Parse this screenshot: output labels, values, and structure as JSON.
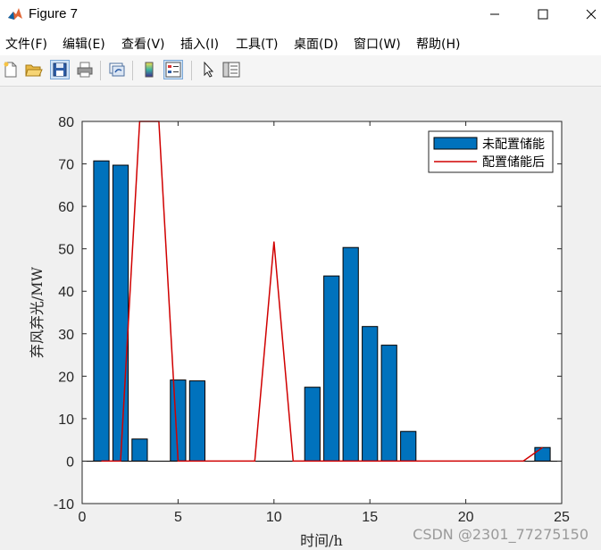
{
  "window": {
    "title": "Figure 7"
  },
  "menu": [
    "文件(F)",
    "编辑(E)",
    "查看(V)",
    "插入(I)",
    "工具(T)",
    "桌面(D)",
    "窗口(W)",
    "帮助(H)"
  ],
  "toolbar": {
    "buttons": [
      "new-figure",
      "open-file",
      "save-figure",
      "print-figure",
      "link-plot",
      "insert-colorbar",
      "insert-legend",
      "edit-plot",
      "property-inspector"
    ]
  },
  "colors": {
    "bar": "#0072BD",
    "line": "#D00000"
  },
  "chart_data": {
    "type": "bar",
    "xlabel": "时间/h",
    "ylabel": "弃风弃光/MW",
    "xlim": [
      0,
      25
    ],
    "ylim": [
      -10,
      80
    ],
    "xticks": [
      0,
      5,
      10,
      15,
      20,
      25
    ],
    "yticks": [
      -10,
      0,
      10,
      20,
      30,
      40,
      50,
      60,
      70,
      80
    ],
    "legend_position": "top-right",
    "series": [
      {
        "name": "未配置储能",
        "type": "bar",
        "x": [
          1,
          2,
          3,
          5,
          6,
          12,
          13,
          14,
          15,
          16,
          17,
          24
        ],
        "values": [
          70.7,
          69.7,
          5.2,
          19.1,
          18.9,
          17.4,
          43.6,
          50.3,
          31.7,
          27.3,
          7.0,
          3.2
        ]
      },
      {
        "name": "配置储能后",
        "type": "line",
        "x": [
          1,
          2,
          3,
          4,
          5,
          6,
          7,
          8,
          9,
          10,
          11,
          12,
          13,
          14,
          15,
          16,
          17,
          18,
          19,
          20,
          21,
          22,
          23,
          24
        ],
        "values": [
          0,
          0,
          80,
          80,
          0,
          0,
          0,
          0,
          0,
          51.7,
          0,
          0,
          0,
          0,
          0,
          0,
          0,
          0,
          0,
          0,
          0,
          0,
          0,
          3.2
        ]
      }
    ]
  },
  "watermark": "CSDN @2301_77275150"
}
